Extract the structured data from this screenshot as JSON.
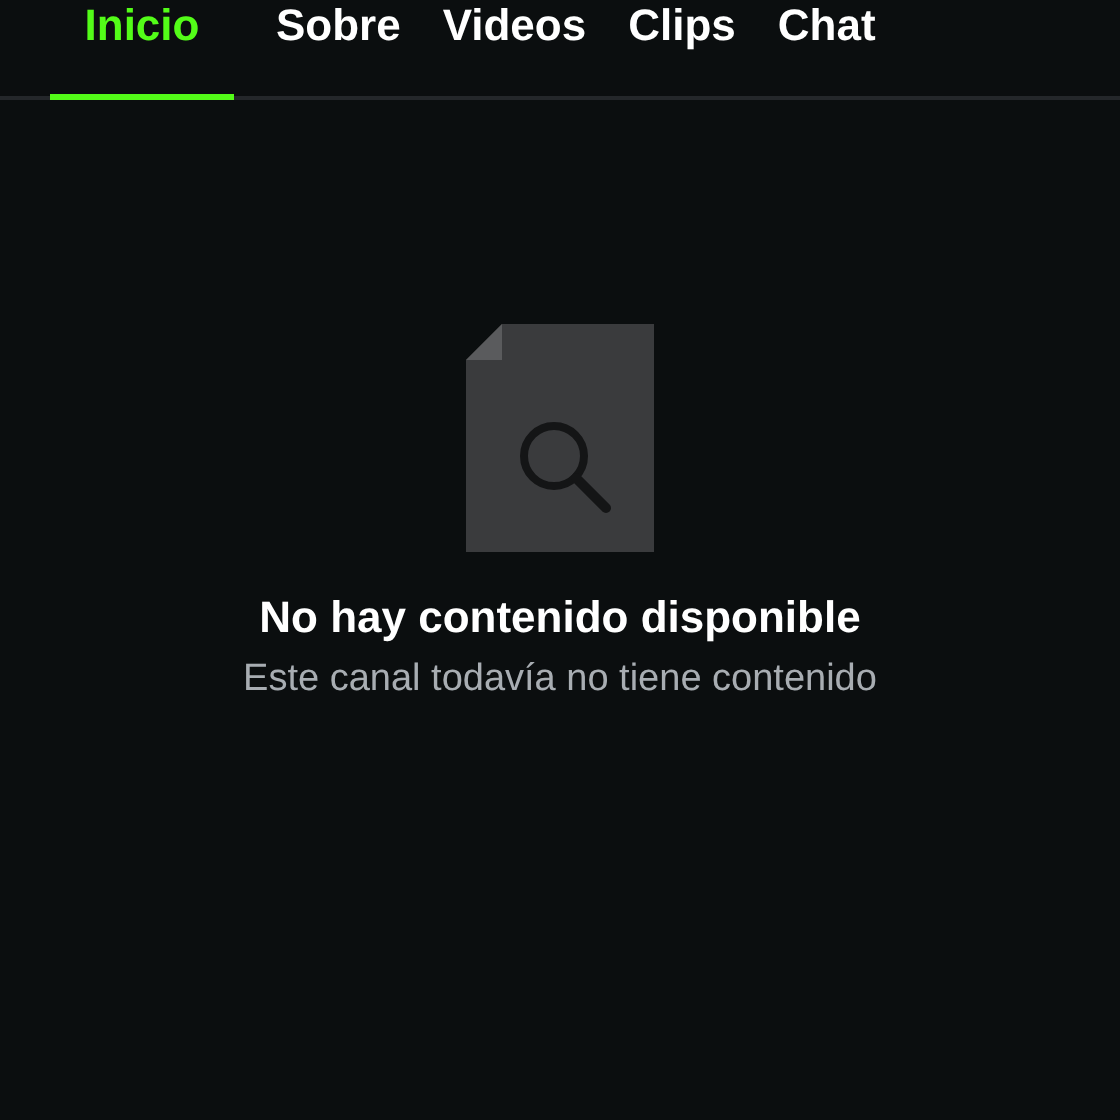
{
  "tabs": [
    {
      "label": "Inicio",
      "selected": true
    },
    {
      "label": "Sobre",
      "selected": false
    },
    {
      "label": "Videos",
      "selected": false
    },
    {
      "label": "Clips",
      "selected": false
    },
    {
      "label": "Chat",
      "selected": false
    }
  ],
  "empty_state": {
    "title": "No hay contenido disponible",
    "message": "Este canal todavía no tiene contenido"
  }
}
